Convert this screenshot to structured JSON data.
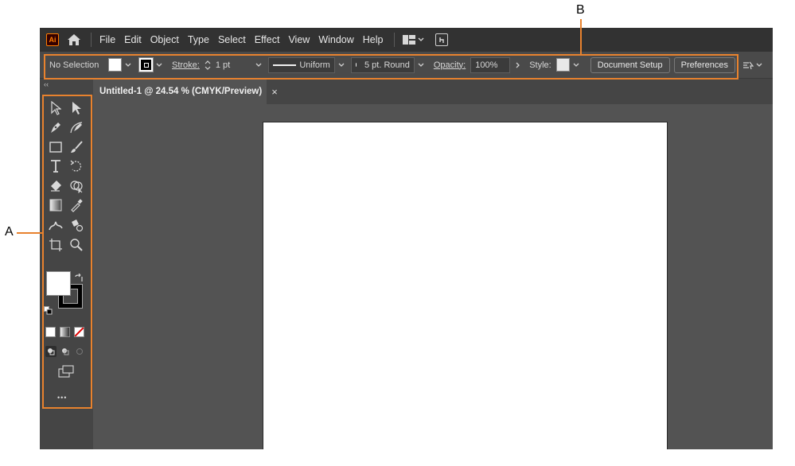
{
  "app": {
    "logo_text": "Ai",
    "menu": [
      "File",
      "Edit",
      "Object",
      "Type",
      "Select",
      "Effect",
      "View",
      "Window",
      "Help"
    ]
  },
  "control_bar": {
    "selection_label": "No Selection",
    "stroke_label": "Stroke:",
    "stroke_weight": "1 pt",
    "profile_label": "Uniform",
    "brush_label": "5 pt. Round",
    "opacity_label": "Opacity:",
    "opacity_value": "100%",
    "style_label": "Style:",
    "document_setup": "Document Setup",
    "preferences": "Preferences"
  },
  "document": {
    "tab_title": "Untitled-1 @ 24.54 % (CMYK/Preview)",
    "close_glyph": "×"
  },
  "toolbar": {
    "more_glyph": "•••",
    "collapse_glyph": "‹‹"
  },
  "annotations": {
    "label_a": "A",
    "label_b": "B",
    "color": "#e8822e"
  }
}
